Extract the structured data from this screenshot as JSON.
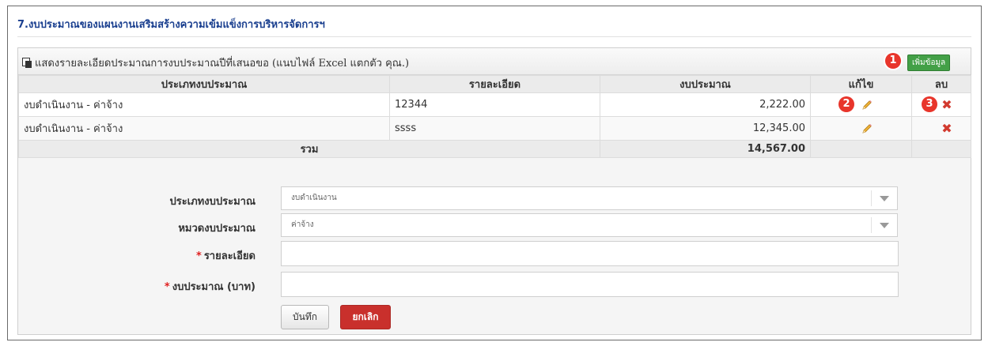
{
  "section": {
    "title": "7.งบประมาณของแผนงานเสริมสร้างความเข้มแข็งการบริหารจัดการฯ"
  },
  "panel": {
    "title": "แสดงรายละเอียดประมาณการงบประมาณปีที่เสนอขอ (แนบไฟล์ Excel แตกตัว คุณ.)",
    "add_button": "เพิ่มข้อมูล",
    "copy_icon": "copy-icon"
  },
  "badges": {
    "b1": "1",
    "b2": "2",
    "b3": "3"
  },
  "table": {
    "headers": {
      "type": "ประเภทงบประมาณ",
      "detail": "รายละเอียด",
      "amount": "งบประมาณ",
      "edit": "แก้ไข",
      "delete": "ลบ"
    },
    "rows": [
      {
        "type": "งบดำเนินงาน - ค่าจ้าง",
        "detail": "12344",
        "amount": "2,222.00"
      },
      {
        "type": "งบดำเนินงาน - ค่าจ้าง",
        "detail": "ssss",
        "amount": "12,345.00"
      }
    ],
    "total_label": "รวม",
    "total_amount": "14,567.00",
    "edit_icon": "pencil-icon",
    "delete_icon": "delete-x-icon"
  },
  "form": {
    "budget_type": {
      "label": "ประเภทงบประมาณ",
      "value": "งบดำเนินงาน"
    },
    "budget_category": {
      "label": "หมวดงบประมาณ",
      "value": "ค่าจ้าง"
    },
    "detail": {
      "required_mark": "*",
      "label": "รายละเอียด",
      "value": ""
    },
    "amount": {
      "required_mark": "*",
      "label": "งบประมาณ (บาท)",
      "value": ""
    },
    "save_button": "บันทึก",
    "cancel_button": "ยกเลิก"
  },
  "colors": {
    "accent_title": "#1a3f8f",
    "badge": "#e8352b",
    "add_button": "#43a047",
    "cancel_button": "#c9302c",
    "delete_icon": "#d23a2f"
  }
}
